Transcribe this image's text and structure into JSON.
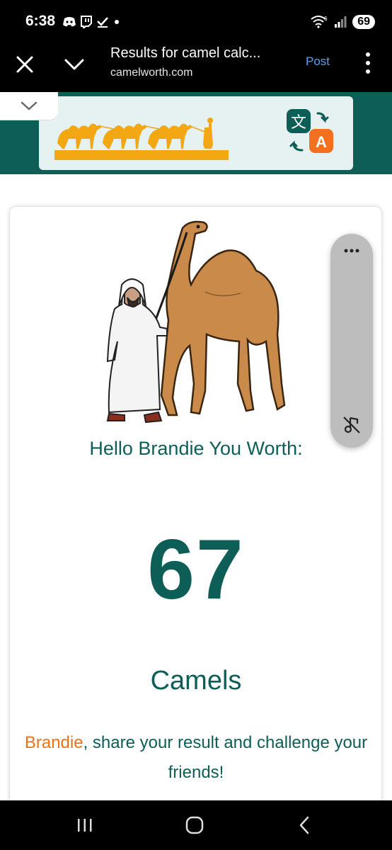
{
  "status_bar": {
    "time": "6:38",
    "battery": "69",
    "network": "6"
  },
  "toolbar": {
    "title": "Results for camel calc...",
    "url": "camelworth.com",
    "post_label": "Post"
  },
  "result": {
    "greeting": "Hello Brandie You Worth:",
    "value": "67",
    "unit": "Camels",
    "share_name": "Brandie",
    "share_text": ", share your result and challenge your friends!"
  },
  "colors": {
    "brand_teal": "#0d5e57",
    "accent_orange": "#e8731c",
    "post_link_blue": "#5aa0f2"
  },
  "icons": {
    "banner_logo": "camel-caravan-logo",
    "translate": "translate-icon",
    "floating_menu": "more-horizontal-icon",
    "floating_mute": "music-off-icon"
  }
}
